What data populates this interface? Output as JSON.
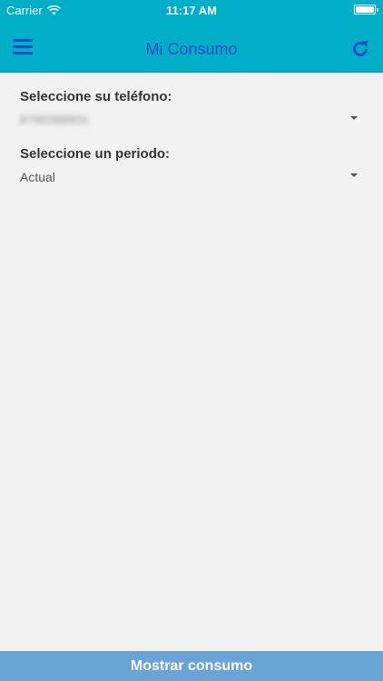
{
  "status_bar": {
    "carrier": "Carrier",
    "time": "11:17 AM"
  },
  "nav": {
    "title": "Mi Consumo",
    "menu_icon": "menu-icon",
    "refresh_icon": "refresh-icon"
  },
  "form": {
    "phone": {
      "label": "Seleccione su teléfono:",
      "value": "8760388831"
    },
    "period": {
      "label": "Seleccione un periodo:",
      "value": "Actual"
    }
  },
  "actions": {
    "show_label": "Mostrar consumo"
  },
  "colors": {
    "header": "#00aec7",
    "accent": "#1f4fc4",
    "button": "#6aa3d5",
    "background": "#f2f2f2"
  }
}
